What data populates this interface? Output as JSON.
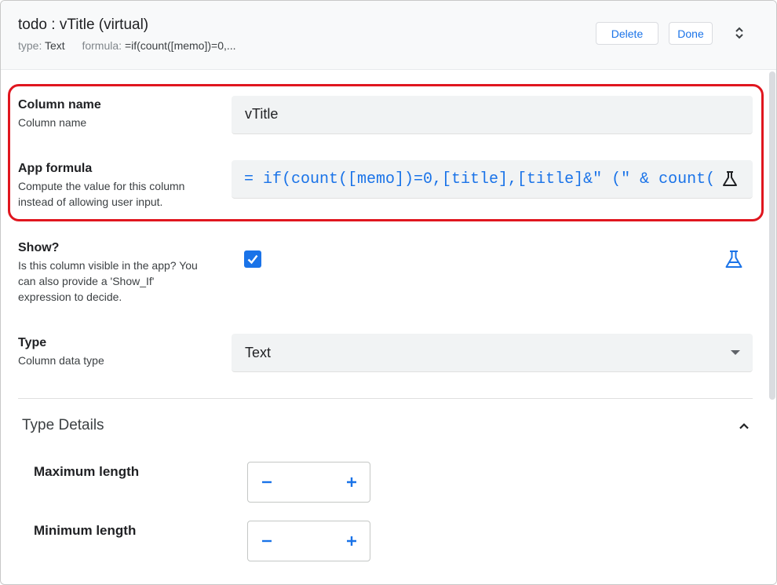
{
  "header": {
    "title": "todo : vTitle (virtual)",
    "type_label": "type:",
    "type_value": "Text",
    "formula_label": "formula:",
    "formula_value": "=if(count([memo])=0,...",
    "delete_label": "Delete",
    "done_label": "Done"
  },
  "fields": {
    "column_name": {
      "label": "Column name",
      "description": "Column name",
      "value": "vTitle"
    },
    "app_formula": {
      "label": "App formula",
      "description": "Compute the value for this column instead of allowing user input.",
      "value": "= if(count([memo])=0,[title],[title]&\" (\" & count("
    },
    "show": {
      "label": "Show?",
      "description": "Is this column visible in the app? You can also provide a 'Show_If' expression to decide.",
      "checked": true
    },
    "type": {
      "label": "Type",
      "description": "Column data type",
      "value": "Text"
    }
  },
  "type_details": {
    "title": "Type Details",
    "max_length_label": "Maximum length",
    "min_length_label": "Minimum length"
  },
  "icons": {
    "expand": "unfold-icon",
    "flask": "flask-icon",
    "collapse": "chevron-up-icon",
    "minus": "minus-icon",
    "plus": "plus-icon"
  },
  "colors": {
    "accent": "#1a73e8",
    "highlight": "#e0161f"
  }
}
